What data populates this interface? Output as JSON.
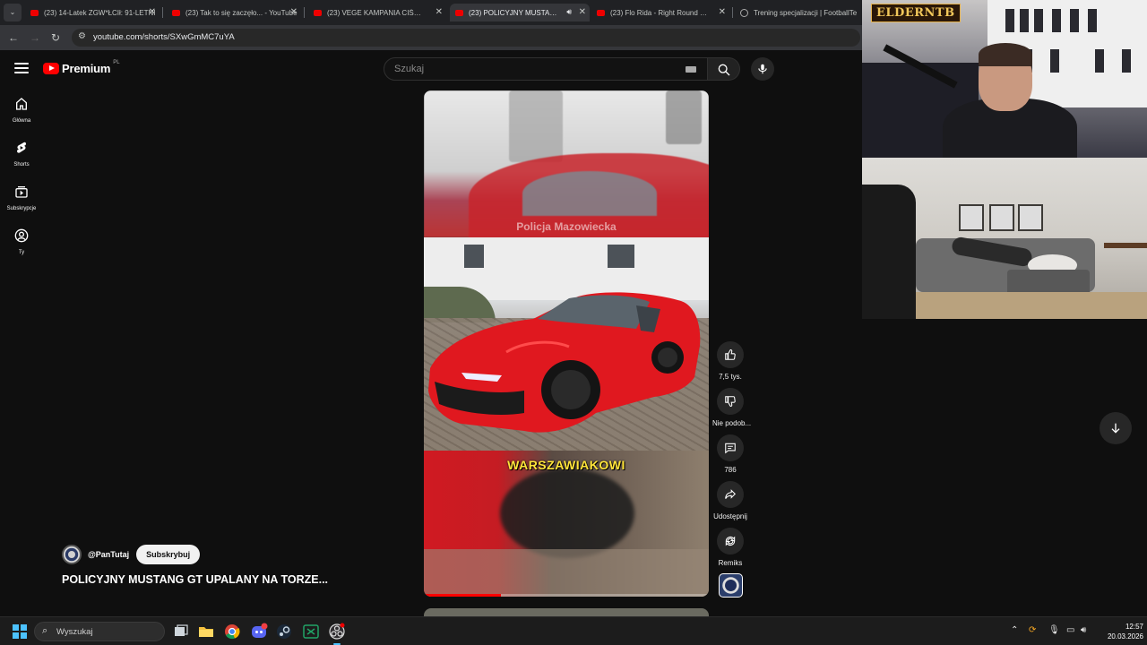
{
  "browser": {
    "tabs": [
      {
        "title": "(23) 14-Latek ZGW*ŁCIł: 91-LETNI",
        "active": false,
        "favicon": "youtube-icon"
      },
      {
        "title": "(23) Tak to się zaczęło... - YouTube",
        "active": false,
        "favicon": "youtube-icon"
      },
      {
        "title": "(23) VEGE KAMPANIA CIŚNIENIA",
        "active": false,
        "favicon": "youtube-icon"
      },
      {
        "title": "(23) POLICYJNY MUSTANG",
        "active": true,
        "favicon": "youtube-icon",
        "audio": true
      },
      {
        "title": "(23) Flo Rida - Right Round (feat",
        "active": false,
        "favicon": "youtube-icon"
      },
      {
        "title": "Trening specjalizacji | FootballTe",
        "active": false,
        "favicon": "globe-icon"
      }
    ],
    "url": "youtube.com/shorts/SXwGmMC7uYA"
  },
  "youtube": {
    "logo_text": "Premium",
    "logo_region": "PL",
    "search_placeholder": "Szukaj",
    "sidebar": [
      {
        "label": "Główna",
        "icon": "home-icon"
      },
      {
        "label": "Shorts",
        "icon": "shorts-icon"
      },
      {
        "label": "Subskrypcje",
        "icon": "subscriptions-icon"
      },
      {
        "label": "Ty",
        "icon": "account-icon"
      }
    ],
    "video": {
      "watermark": "Policja Mazowiecka",
      "caption": "WARSZAWIAKOWI",
      "progress": 0.27
    },
    "actions": {
      "like_count": "7,5 tys.",
      "dislike_label": "Nie podob...",
      "comments_count": "786",
      "share_label": "Udostępnij",
      "remix_label": "Remiks"
    },
    "channel": {
      "handle": "@PanTutaj",
      "subscribe_label": "Subskrybuj",
      "avatar_text": "PAN TUTAJ"
    },
    "short_title": "POLICYJNY MUSTANG GT UPALANY NA TORZE..."
  },
  "webcam": {
    "overlay_logo": "ELDERNTB"
  },
  "taskbar": {
    "search_placeholder": "Wyszukaj",
    "time": "12:57",
    "date": "20.03.2026",
    "apps": [
      "task-view-icon",
      "file-explorer-icon",
      "chrome-icon",
      "discord-icon",
      "steam-icon",
      "excel-icon",
      "obs-icon"
    ]
  },
  "colors": {
    "accent_red": "#ff0000",
    "caption_yellow": "#ffe43a",
    "windows_blue": "#4cc2ff"
  }
}
